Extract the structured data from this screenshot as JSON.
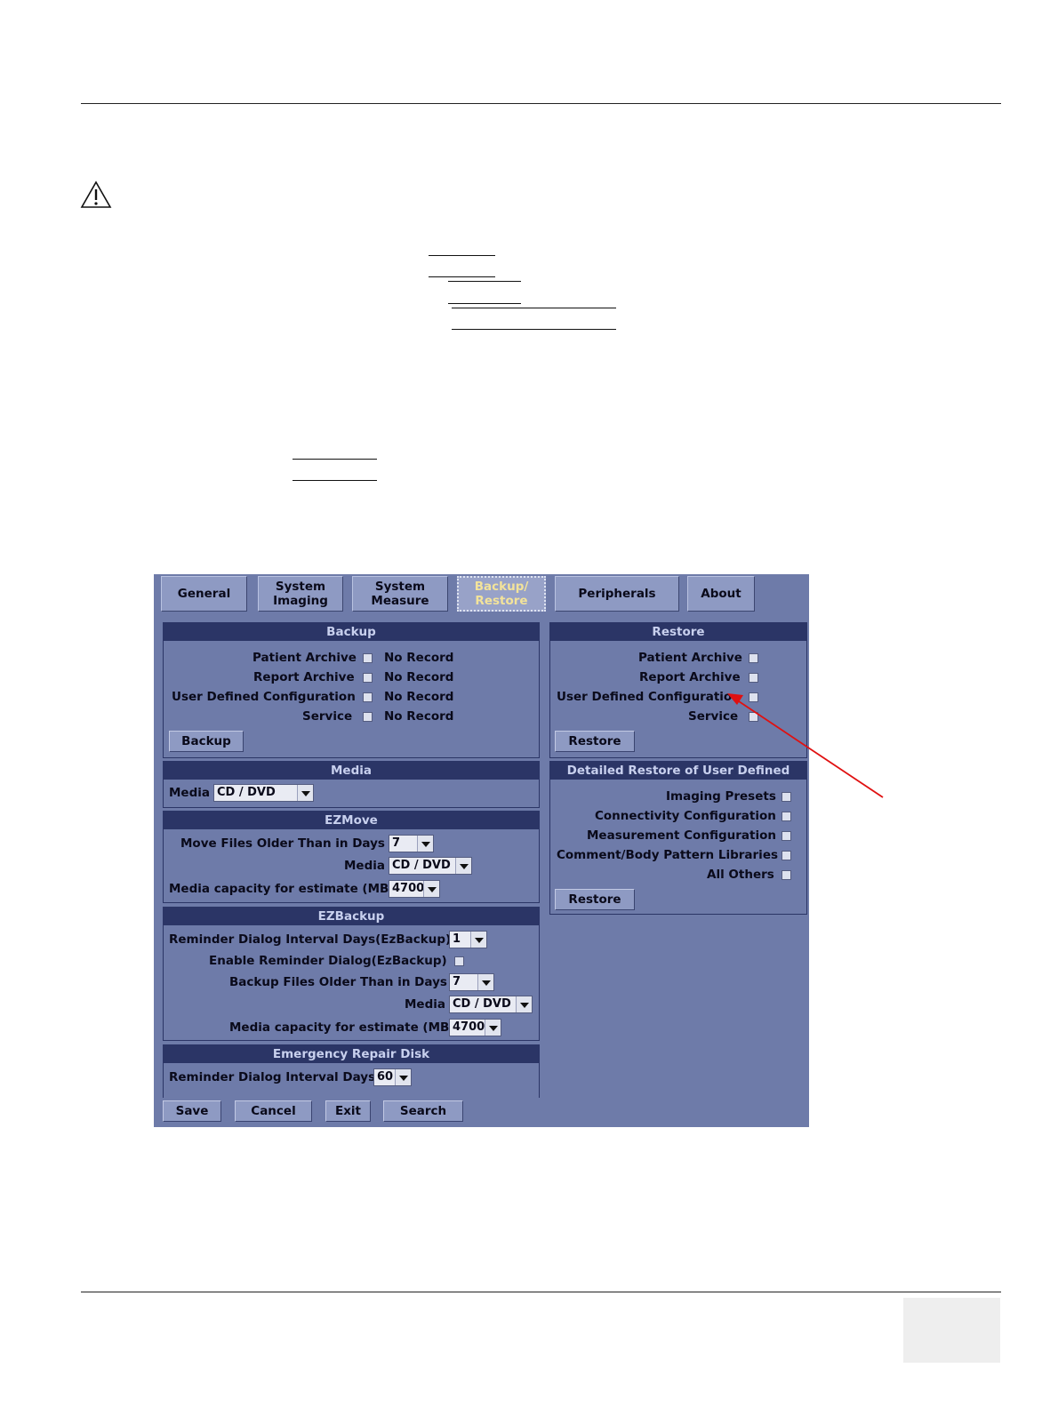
{
  "tabs": [
    {
      "label": "General"
    },
    {
      "label": "System\nImaging"
    },
    {
      "label": "System\nMeasure"
    },
    {
      "label": "Backup/\nRestore",
      "active": true
    },
    {
      "label": "Peripherals"
    },
    {
      "label": "About"
    }
  ],
  "backup": {
    "title": "Backup",
    "rows": [
      {
        "label": "Patient Archive",
        "status": "No Record"
      },
      {
        "label": "Report Archive",
        "status": "No Record"
      },
      {
        "label": "User Defined Configuration",
        "status": "No Record"
      },
      {
        "label": "Service",
        "status": "No Record"
      }
    ],
    "button": "Backup"
  },
  "restore": {
    "title": "Restore",
    "rows": [
      {
        "label": "Patient Archive"
      },
      {
        "label": "Report Archive"
      },
      {
        "label": "User Defined Configuratio"
      },
      {
        "label": "Service"
      }
    ],
    "button": "Restore"
  },
  "media": {
    "title": "Media",
    "label": "Media",
    "value": "CD / DVD"
  },
  "detailed_restore": {
    "title": "Detailed Restore of User Defined",
    "rows": [
      {
        "label": "Imaging Presets"
      },
      {
        "label": "Connectivity Configuration"
      },
      {
        "label": "Measurement Configuration"
      },
      {
        "label": "Comment/Body Pattern Libraries"
      },
      {
        "label": "All Others"
      }
    ],
    "button": "Restore"
  },
  "ezmove": {
    "title": "EZMove",
    "days_label": "Move Files Older Than in Days",
    "days_value": "7",
    "media_label": "Media",
    "media_value": "CD / DVD",
    "capacity_label": "Media capacity for estimate (MB)",
    "capacity_value": "4700"
  },
  "ezbackup": {
    "title": "EZBackup",
    "interval_label": "Reminder Dialog Interval Days(EzBackup)",
    "interval_value": "1",
    "enable_label": "Enable Reminder Dialog(EzBackup)",
    "older_label": "Backup Files Older Than in Days",
    "older_value": "7",
    "media_label": "Media",
    "media_value": "CD / DVD",
    "capacity_label": "Media capacity for estimate (MB)",
    "capacity_value": "4700"
  },
  "erd": {
    "title": "Emergency Repair Disk",
    "interval_label": "Reminder Dialog Interval Days",
    "interval_value": "60"
  },
  "bottom": {
    "save": "Save",
    "cancel": "Cancel",
    "exit": "Exit",
    "search": "Search"
  },
  "colors": {
    "panel_bg": "#6e7ba9",
    "group_header": "#2b3566",
    "active_tab_text": "#f3e39a",
    "annotation_arrow": "#e01010"
  }
}
